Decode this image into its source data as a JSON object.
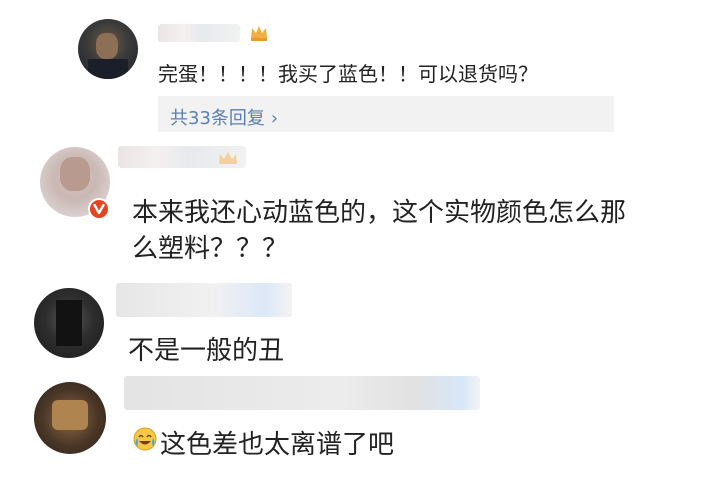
{
  "comments": [
    {
      "text": "完蛋！！！！我买了蓝色！！可以退货吗？",
      "replies_label": "共33条回复",
      "chevron_icon": "chevron-right-icon",
      "badge_icon": "crown-badge-icon"
    },
    {
      "line1": "本来我还心动蓝色的，这个实物颜色怎么那",
      "line2": "么塑料？？？",
      "badge_icon": "verified-v-badge-icon",
      "verified_color": "#e4441f"
    },
    {
      "text": "不是一般的丑"
    },
    {
      "text": "这色差也太离谱了吧",
      "emoji_icon": "crying-laughing-emoji-icon"
    }
  ],
  "colors": {
    "link": "#5b80b3",
    "reply_bg": "#f2f2f2",
    "text": "#222222"
  }
}
